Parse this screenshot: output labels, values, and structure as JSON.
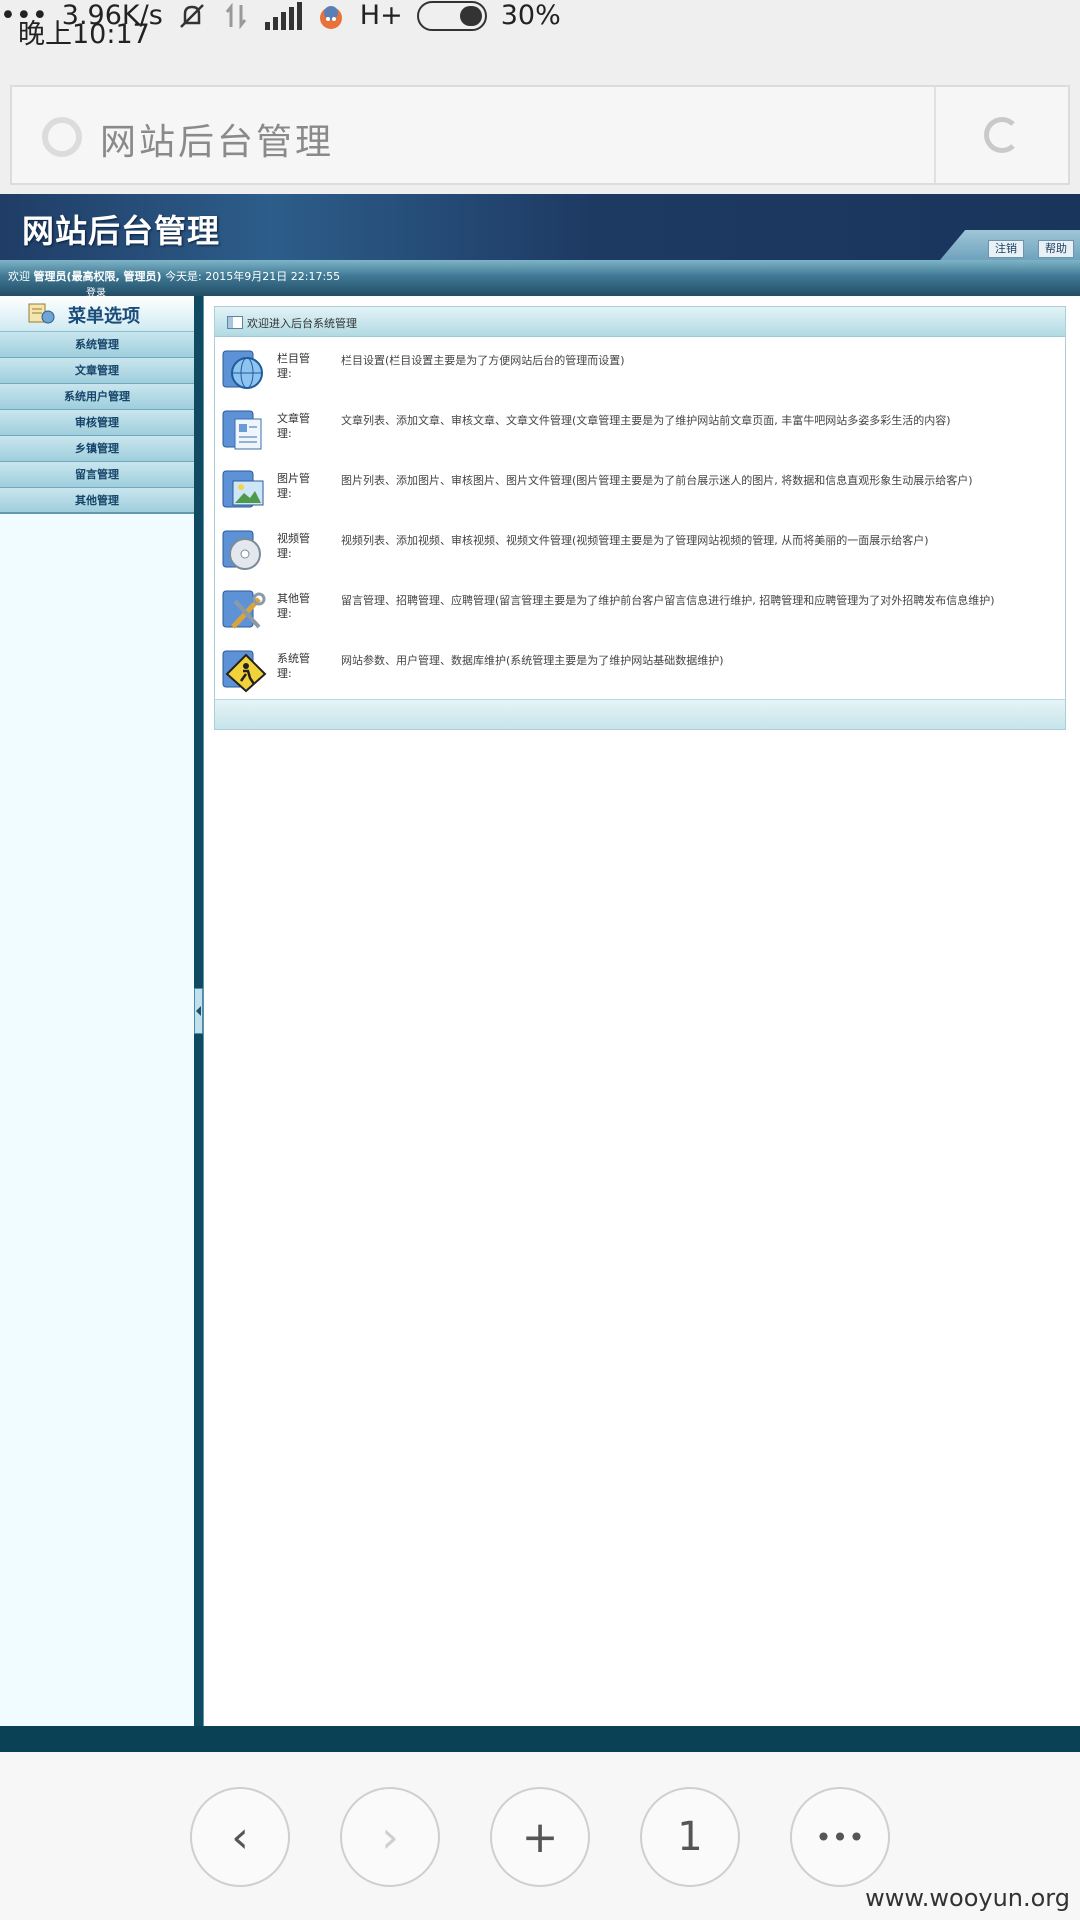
{
  "status_bar": {
    "time": "晚上10:17",
    "net_speed": "3.96K/s",
    "network": "H+",
    "battery": "30%",
    "battery_level": 0.3,
    "icons": [
      "more-dots-icon",
      "mute-bell-icon",
      "data-arrows-icon",
      "signal-icon",
      "app-badge-icon",
      "battery-icon"
    ]
  },
  "browser": {
    "address_title": "网站后台管理",
    "reload_icon": "reload-icon"
  },
  "header": {
    "logo_text": "网站后台管理",
    "logout_label": "注销",
    "help_label": "帮助",
    "welcome_prefix": "欢迎",
    "user_role": "管理员(最高权限, 管理员)",
    "today_label": "今天是:",
    "datetime": "2015年9月21日 22:17:55",
    "login_label": "登录"
  },
  "sidebar": {
    "title": "菜单选项",
    "items": [
      {
        "label": "系统管理"
      },
      {
        "label": "文章管理"
      },
      {
        "label": "系统用户管理"
      },
      {
        "label": "审核管理"
      },
      {
        "label": "乡镇管理"
      },
      {
        "label": "留言管理"
      },
      {
        "label": "其他管理"
      }
    ]
  },
  "panel": {
    "title": "欢迎进入后台系统管理",
    "modules": [
      {
        "name": "栏目管理:",
        "desc": "栏目设置(栏目设置主要是为了方便网站后台的管理而设置)",
        "icon": "globe-icon"
      },
      {
        "name": "文章管理:",
        "desc": "文章列表、添加文章、审核文章、文章文件管理(文章管理主要是为了维护网站前文章页面, 丰富牛吧网站多姿多彩生活的内容)",
        "icon": "document-icon"
      },
      {
        "name": "图片管理:",
        "desc": "图片列表、添加图片、审核图片、图片文件管理(图片管理主要是为了前台展示迷人的图片, 将数据和信息直观形象生动展示给客户)",
        "icon": "image-icon"
      },
      {
        "name": "视频管理:",
        "desc": "视频列表、添加视频、审核视频、视频文件管理(视频管理主要是为了管理网站视频的管理, 从而将美丽的一面展示给客户)",
        "icon": "disc-icon"
      },
      {
        "name": "其他管理:",
        "desc": "留言管理、招聘管理、应聘管理(留言管理主要是为了维护前台客户留言信息进行维护, 招聘管理和应聘管理为了对外招聘发布信息维护)",
        "icon": "tools-icon"
      },
      {
        "name": "系统管理:",
        "desc": "网站参数、用户管理、数据库维护(系统管理主要是为了维护网站基础数据维护)",
        "icon": "warning-sign-icon"
      }
    ]
  },
  "nav": {
    "back": "‹",
    "forward": "›",
    "new_tab": "+",
    "tabs_count": "1",
    "more": "•••"
  },
  "watermark": "www.wooyun.org"
}
